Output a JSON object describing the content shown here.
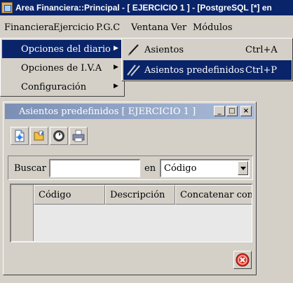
{
  "window": {
    "title": "Area Financiera::Principal  - [ EJERCICIO 1 ] - [PostgreSQL [*] en"
  },
  "menubar": {
    "items": [
      "Financiera",
      "Ejercicio",
      "P.G.C",
      "Ventana",
      "Ver",
      "Módulos"
    ]
  },
  "dropdown": {
    "items": [
      {
        "label": "Opciones del diario",
        "arrow": "▶"
      },
      {
        "label": "Opciones de I.V.A",
        "arrow": "▶"
      },
      {
        "label": "Configuración",
        "arrow": "▶"
      }
    ]
  },
  "submenu": {
    "items": [
      {
        "label": "Asientos",
        "shortcut": "Ctrl+A",
        "icon": "pen-icon"
      },
      {
        "label": "Asientos predefinidos",
        "shortcut": "Ctrl+P",
        "icon": "double-pen-icon"
      }
    ]
  },
  "child_window": {
    "title": "Asientos predefinidos [ EJERCICIO 1 ]",
    "minimize": "_",
    "maximize": "□",
    "close": "×",
    "toolbar": [
      "new-document-icon",
      "open-folder-icon",
      "refresh-icon",
      "print-icon"
    ],
    "search": {
      "label": "Buscar",
      "value": "",
      "in_label": "en",
      "field_value": "Código"
    },
    "table": {
      "columns": [
        "Código",
        "Descripción",
        "Concatenar con"
      ],
      "rows": []
    },
    "close_button_icon": "close-circle-icon"
  },
  "colors": {
    "titlebar": "#0a246a",
    "highlight": "#0a246a",
    "face": "#d4d0c8",
    "inactive_title": "#7b8fb4"
  }
}
